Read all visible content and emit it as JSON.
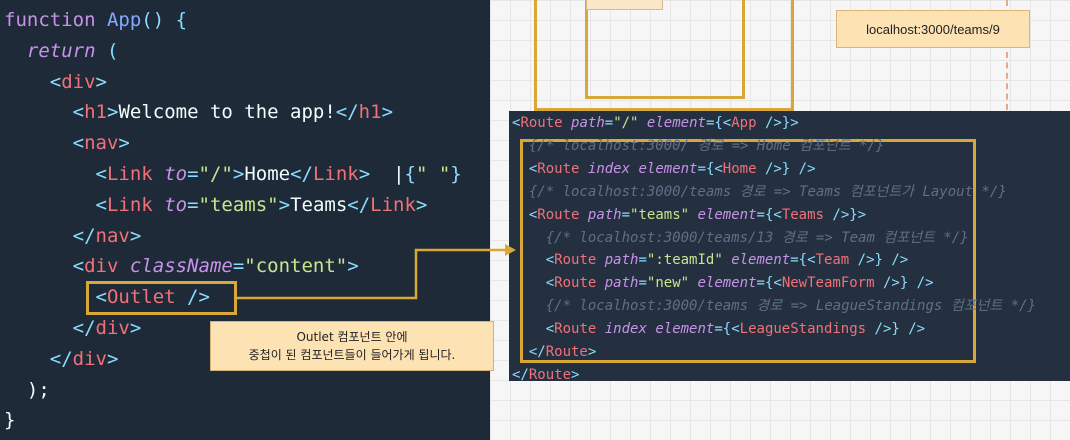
{
  "code": {
    "lines": [
      [
        {
          "t": "function ",
          "c": "kw"
        },
        {
          "t": "App",
          "c": "fn"
        },
        {
          "t": "() {",
          "c": "punc"
        }
      ],
      [
        {
          "t": "  "
        },
        {
          "t": "return",
          "c": "it"
        },
        {
          "t": " (",
          "c": "punc"
        }
      ],
      [
        {
          "t": "    "
        },
        {
          "t": "<",
          "c": "punc"
        },
        {
          "t": "div",
          "c": "tag"
        },
        {
          "t": ">",
          "c": "punc"
        }
      ],
      [
        {
          "t": "      "
        },
        {
          "t": "<",
          "c": "punc"
        },
        {
          "t": "h1",
          "c": "tag"
        },
        {
          "t": ">",
          "c": "punc"
        },
        {
          "t": "Welcome to the app!",
          "c": "text"
        },
        {
          "t": "</",
          "c": "punc"
        },
        {
          "t": "h1",
          "c": "tag"
        },
        {
          "t": ">",
          "c": "punc"
        }
      ],
      [
        {
          "t": "      "
        },
        {
          "t": "<",
          "c": "punc"
        },
        {
          "t": "nav",
          "c": "tag"
        },
        {
          "t": ">",
          "c": "punc"
        }
      ],
      [
        {
          "t": "        "
        },
        {
          "t": "<",
          "c": "punc"
        },
        {
          "t": "Link",
          "c": "tag"
        },
        {
          "t": " "
        },
        {
          "t": "to",
          "c": "attr"
        },
        {
          "t": "=",
          "c": "punc"
        },
        {
          "t": "\"/\"",
          "c": "str"
        },
        {
          "t": ">",
          "c": "punc"
        },
        {
          "t": "Home",
          "c": "text"
        },
        {
          "t": "</",
          "c": "punc"
        },
        {
          "t": "Link",
          "c": "tag"
        },
        {
          "t": ">",
          "c": "punc"
        },
        {
          "t": "  |",
          "c": "text"
        },
        {
          "t": "{",
          "c": "punc"
        },
        {
          "t": "\" \"",
          "c": "str"
        },
        {
          "t": "}",
          "c": "punc"
        }
      ],
      [
        {
          "t": "        "
        },
        {
          "t": "<",
          "c": "punc"
        },
        {
          "t": "Link",
          "c": "tag"
        },
        {
          "t": " "
        },
        {
          "t": "to",
          "c": "attr"
        },
        {
          "t": "=",
          "c": "punc"
        },
        {
          "t": "\"teams\"",
          "c": "str"
        },
        {
          "t": ">",
          "c": "punc"
        },
        {
          "t": "Teams",
          "c": "text"
        },
        {
          "t": "</",
          "c": "punc"
        },
        {
          "t": "Link",
          "c": "tag"
        },
        {
          "t": ">",
          "c": "punc"
        }
      ],
      [
        {
          "t": "      "
        },
        {
          "t": "</",
          "c": "punc"
        },
        {
          "t": "nav",
          "c": "tag"
        },
        {
          "t": ">",
          "c": "punc"
        }
      ],
      [
        {
          "t": "      "
        },
        {
          "t": "<",
          "c": "punc"
        },
        {
          "t": "div",
          "c": "tag"
        },
        {
          "t": " "
        },
        {
          "t": "className",
          "c": "attr"
        },
        {
          "t": "=",
          "c": "punc"
        },
        {
          "t": "\"content\"",
          "c": "str"
        },
        {
          "t": ">",
          "c": "punc"
        }
      ],
      [
        {
          "t": "        "
        },
        {
          "t": "<",
          "c": "punc"
        },
        {
          "t": "Outlet",
          "c": "tag"
        },
        {
          "t": " />",
          "c": "punc"
        }
      ],
      [
        {
          "t": "      "
        },
        {
          "t": "</",
          "c": "punc"
        },
        {
          "t": "div",
          "c": "tag"
        },
        {
          "t": ">",
          "c": "punc"
        }
      ],
      [
        {
          "t": "    "
        },
        {
          "t": "</",
          "c": "punc"
        },
        {
          "t": "div",
          "c": "tag"
        },
        {
          "t": ">",
          "c": "punc"
        }
      ],
      [
        {
          "t": "  );",
          "c": "text"
        }
      ],
      [
        {
          "t": "}",
          "c": "text"
        }
      ]
    ]
  },
  "routes": {
    "lines": [
      [
        {
          "t": "<",
          "c": "punc"
        },
        {
          "t": "Route",
          "c": "tag"
        },
        {
          "t": " "
        },
        {
          "t": "path",
          "c": "attr"
        },
        {
          "t": "=",
          "c": "punc"
        },
        {
          "t": "\"/\"",
          "c": "str"
        },
        {
          "t": " "
        },
        {
          "t": "element",
          "c": "attr"
        },
        {
          "t": "=",
          "c": "punc"
        },
        {
          "t": "{<",
          "c": "punc"
        },
        {
          "t": "App",
          "c": "tag"
        },
        {
          "t": " />}>",
          "c": "punc"
        }
      ],
      [
        {
          "t": "  "
        },
        {
          "t": "{/* localhost:3000/ 경로 => Home 컴포넌트 */}",
          "c": "cm"
        }
      ],
      [
        {
          "t": "  "
        },
        {
          "t": "<",
          "c": "punc"
        },
        {
          "t": "Route",
          "c": "tag"
        },
        {
          "t": " "
        },
        {
          "t": "index",
          "c": "attr"
        },
        {
          "t": " "
        },
        {
          "t": "element",
          "c": "attr"
        },
        {
          "t": "=",
          "c": "punc"
        },
        {
          "t": "{<",
          "c": "punc"
        },
        {
          "t": "Home",
          "c": "tag"
        },
        {
          "t": " />} />",
          "c": "punc"
        }
      ],
      [
        {
          "t": "  "
        },
        {
          "t": "{/* localhost:3000/teams 경로 => Teams 컴포넌트가 Layout */}",
          "c": "cm"
        }
      ],
      [
        {
          "t": "  "
        },
        {
          "t": "<",
          "c": "punc"
        },
        {
          "t": "Route",
          "c": "tag"
        },
        {
          "t": " "
        },
        {
          "t": "path",
          "c": "attr"
        },
        {
          "t": "=",
          "c": "punc"
        },
        {
          "t": "\"teams\"",
          "c": "str"
        },
        {
          "t": " "
        },
        {
          "t": "element",
          "c": "attr"
        },
        {
          "t": "=",
          "c": "punc"
        },
        {
          "t": "{<",
          "c": "punc"
        },
        {
          "t": "Teams",
          "c": "tag"
        },
        {
          "t": " />}>",
          "c": "punc"
        }
      ],
      [
        {
          "t": "    "
        },
        {
          "t": "{/* localhost:3000/teams/13 경로 => Team 컴포넌트 */}",
          "c": "cm"
        }
      ],
      [
        {
          "t": "    "
        },
        {
          "t": "<",
          "c": "punc"
        },
        {
          "t": "Route",
          "c": "tag"
        },
        {
          "t": " "
        },
        {
          "t": "path",
          "c": "attr"
        },
        {
          "t": "=",
          "c": "punc"
        },
        {
          "t": "\":teamId\"",
          "c": "str"
        },
        {
          "t": " "
        },
        {
          "t": "element",
          "c": "attr"
        },
        {
          "t": "=",
          "c": "punc"
        },
        {
          "t": "{<",
          "c": "punc"
        },
        {
          "t": "Team",
          "c": "tag"
        },
        {
          "t": " />} />",
          "c": "punc"
        }
      ],
      [
        {
          "t": "    "
        },
        {
          "t": "<",
          "c": "punc"
        },
        {
          "t": "Route",
          "c": "tag"
        },
        {
          "t": " "
        },
        {
          "t": "path",
          "c": "attr"
        },
        {
          "t": "=",
          "c": "punc"
        },
        {
          "t": "\"new\"",
          "c": "str"
        },
        {
          "t": " "
        },
        {
          "t": "element",
          "c": "attr"
        },
        {
          "t": "=",
          "c": "punc"
        },
        {
          "t": "{<",
          "c": "punc"
        },
        {
          "t": "NewTeamForm",
          "c": "tag"
        },
        {
          "t": " />} />",
          "c": "punc"
        }
      ],
      [
        {
          "t": "    "
        },
        {
          "t": "{/* localhost:3000/teams 경로 => LeagueStandings 컴포넌트 */}",
          "c": "cm"
        }
      ],
      [
        {
          "t": "    "
        },
        {
          "t": "<",
          "c": "punc"
        },
        {
          "t": "Route",
          "c": "tag"
        },
        {
          "t": " "
        },
        {
          "t": "index",
          "c": "attr"
        },
        {
          "t": " "
        },
        {
          "t": "element",
          "c": "attr"
        },
        {
          "t": "=",
          "c": "punc"
        },
        {
          "t": "{<",
          "c": "punc"
        },
        {
          "t": "LeagueStandings",
          "c": "tag"
        },
        {
          "t": " />} />",
          "c": "punc"
        }
      ],
      [
        {
          "t": "  "
        },
        {
          "t": "</",
          "c": "punc"
        },
        {
          "t": "Route",
          "c": "tag"
        },
        {
          "t": ">",
          "c": "punc"
        }
      ],
      [
        {
          "t": "</",
          "c": "punc"
        },
        {
          "t": "Route",
          "c": "tag"
        },
        {
          "t": ">",
          "c": "punc"
        }
      ]
    ]
  },
  "url_box": {
    "text": "localhost:3000/teams/9"
  },
  "tooltip": {
    "line1": "Outlet 컴포넌트 안에",
    "line2": "중첩이 된 컴포넌트들이 들어가게 됩니다."
  },
  "colors": {
    "accent": "#d8a737",
    "editor_bg": "#1f2a38",
    "note_bg": "#fde2b4"
  }
}
